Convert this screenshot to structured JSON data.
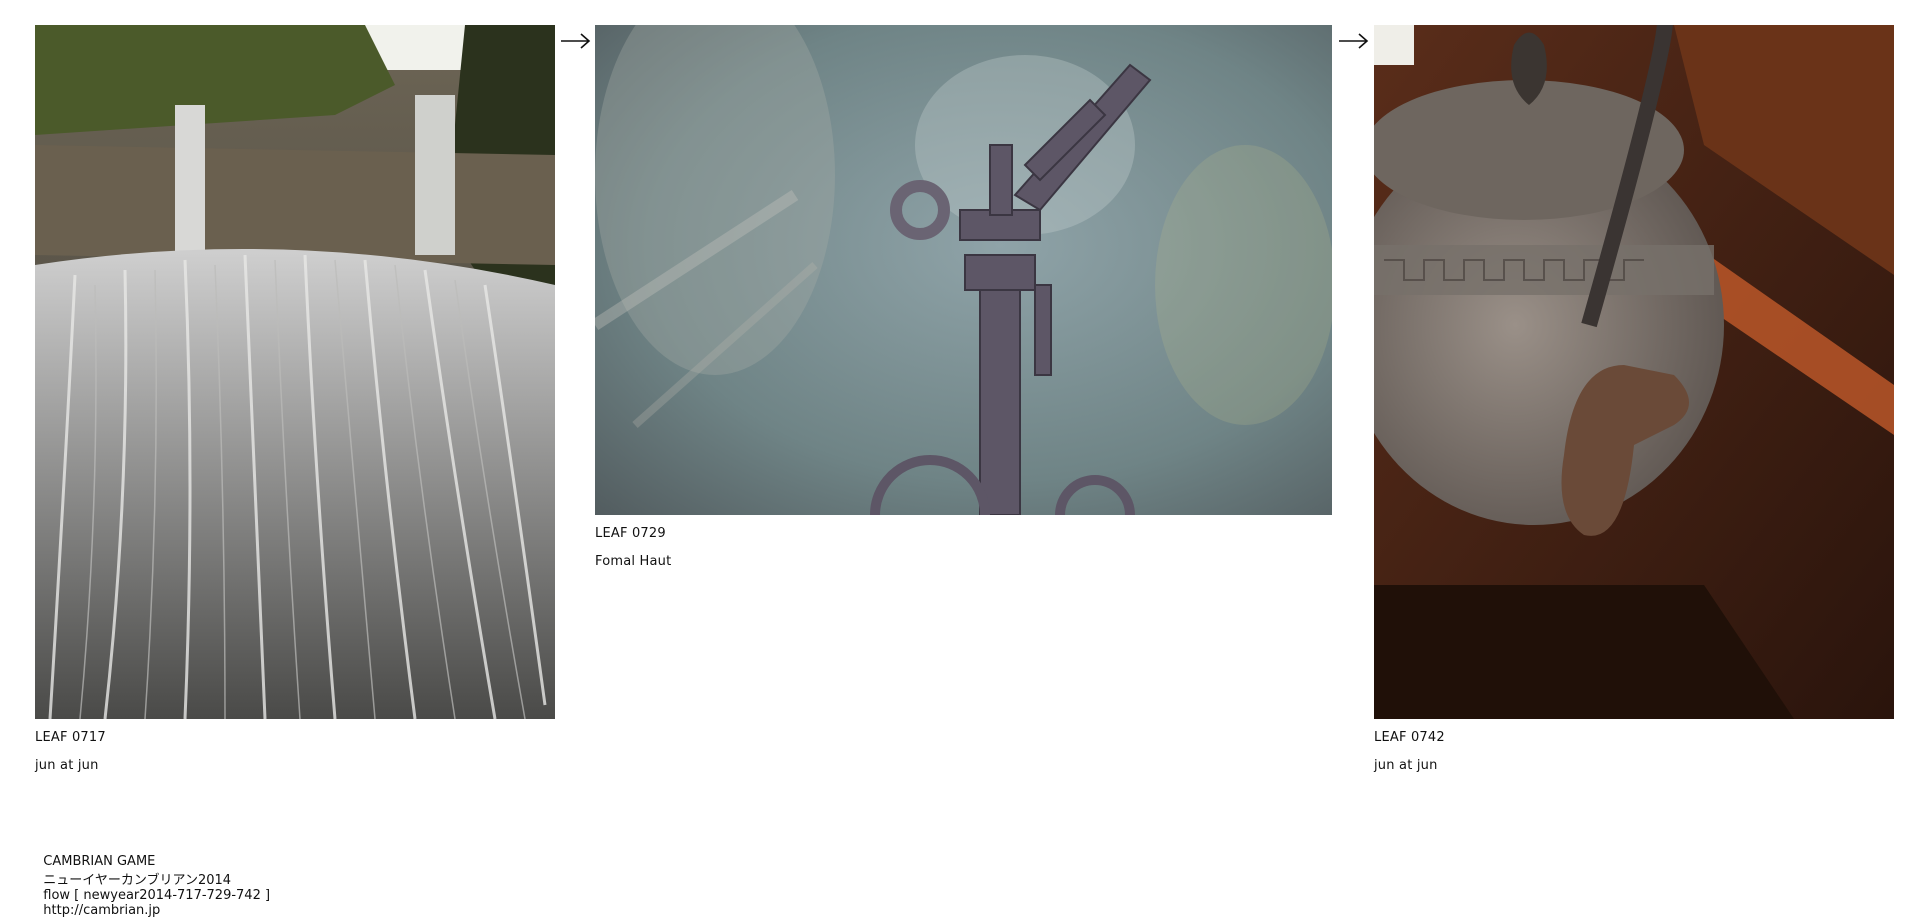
{
  "leaves": [
    {
      "title": "LEAF 0717",
      "author": "jun at jun",
      "image": "waterfall photo"
    },
    {
      "title": "LEAF 0729",
      "author": "Fomal Haut",
      "image": "rusty sprinkler photo"
    },
    {
      "title": "LEAF 0742",
      "author": "jun at jun",
      "image": "iron kettle photo"
    }
  ],
  "arrow_icon": "right-arrow-icon",
  "footer": {
    "brand": "CAMBRIAN GAME",
    "event": "ニューイヤーカンブリアン2014",
    "flow": "flow [ newyear2014-717-729-742 ]",
    "url": "http://cambrian.jp"
  }
}
